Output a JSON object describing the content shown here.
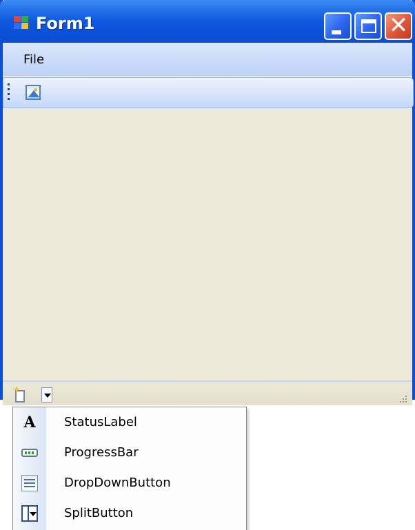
{
  "window": {
    "title": "Form1",
    "icon": "windows-form-icon",
    "caption_buttons": [
      "minimize-icon",
      "maximize-icon",
      "close-icon"
    ]
  },
  "menubar": {
    "items": [
      {
        "label": "File"
      }
    ]
  },
  "toolbar": {
    "items": [
      {
        "icon": "image-icon"
      }
    ]
  },
  "statusstrip": {
    "split_button": {
      "icon": "new-item-icon",
      "arrow": "chevron-down-icon"
    }
  },
  "dropdown": {
    "items": [
      {
        "label": "StatusLabel",
        "icon": "status-label-icon"
      },
      {
        "label": "ProgressBar",
        "icon": "progress-bar-icon"
      },
      {
        "label": "DropDownButton",
        "icon": "dropdown-button-icon"
      },
      {
        "label": "SplitButton",
        "icon": "split-button-icon"
      }
    ]
  },
  "colors": {
    "titlebar": "#0a50d8",
    "client": "#ece9d8",
    "menubar": "#c7dafa",
    "close_button": "#e0553a"
  }
}
